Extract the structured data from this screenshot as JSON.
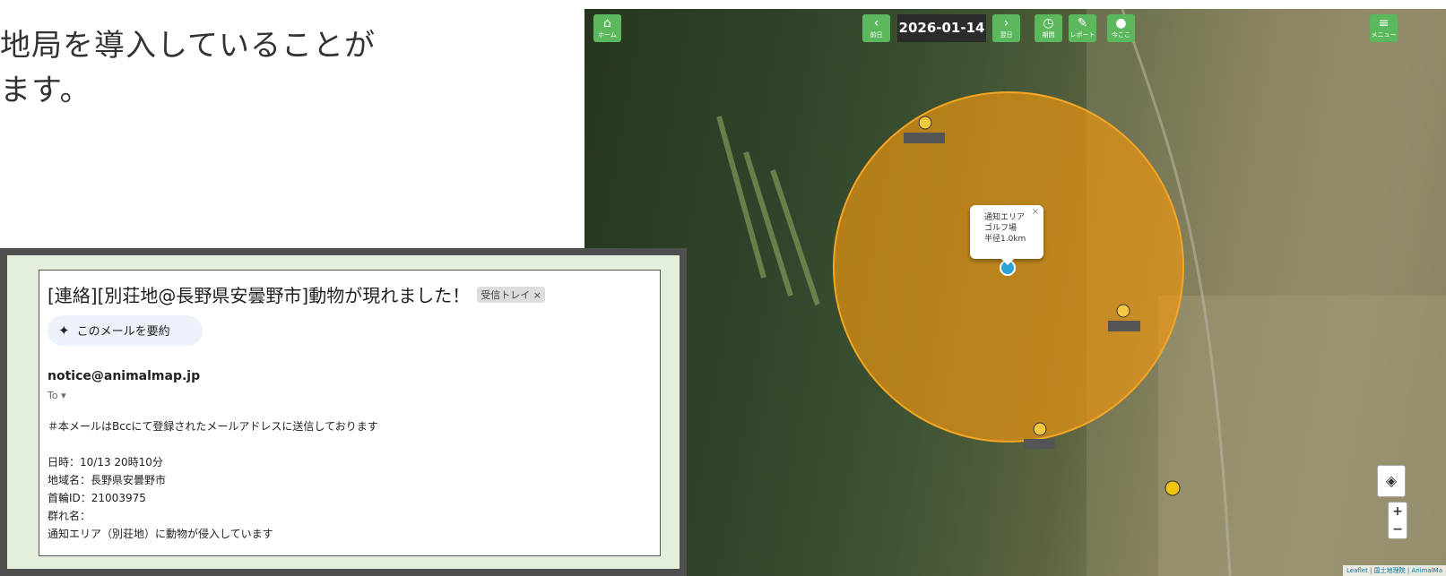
{
  "intro": {
    "line1": "地局を導入していることが",
    "line2": "ます。"
  },
  "map": {
    "home": "ホーム",
    "prev": "前日",
    "date": "2026-01-14",
    "next": "翌日",
    "period": "期間",
    "report": "レポート",
    "here": "今ここ",
    "menu": "メニュー",
    "popup": {
      "line1": "通知エリア",
      "line2": "ゴルフ場",
      "line3": "半径1.0km",
      "close": "×"
    },
    "zoom_in": "+",
    "zoom_out": "−",
    "attribution": "Leaflet | 国土地理院 | AnimalMa"
  },
  "email": {
    "subject": "[連絡][別荘地@長野県安曇野市]動物が現れました！",
    "tag": "受信トレイ ×",
    "summarize": "このメールを要約",
    "sender": "notice@animalmap.jp",
    "to": "To ▾",
    "body": [
      "＃本メールはBccにて登録されたメールアドレスに送信しております",
      "",
      "日時：10/13 20時10分",
      "地域名：長野県安曇野市",
      "首輪ID：21003975",
      "群れ名：",
      "通知エリア（別荘地）に動物が侵入しています"
    ]
  },
  "colors": {
    "button_green": "#5cb85c",
    "area_orange": "#f0960f",
    "date_bg": "#2b2b2b"
  }
}
